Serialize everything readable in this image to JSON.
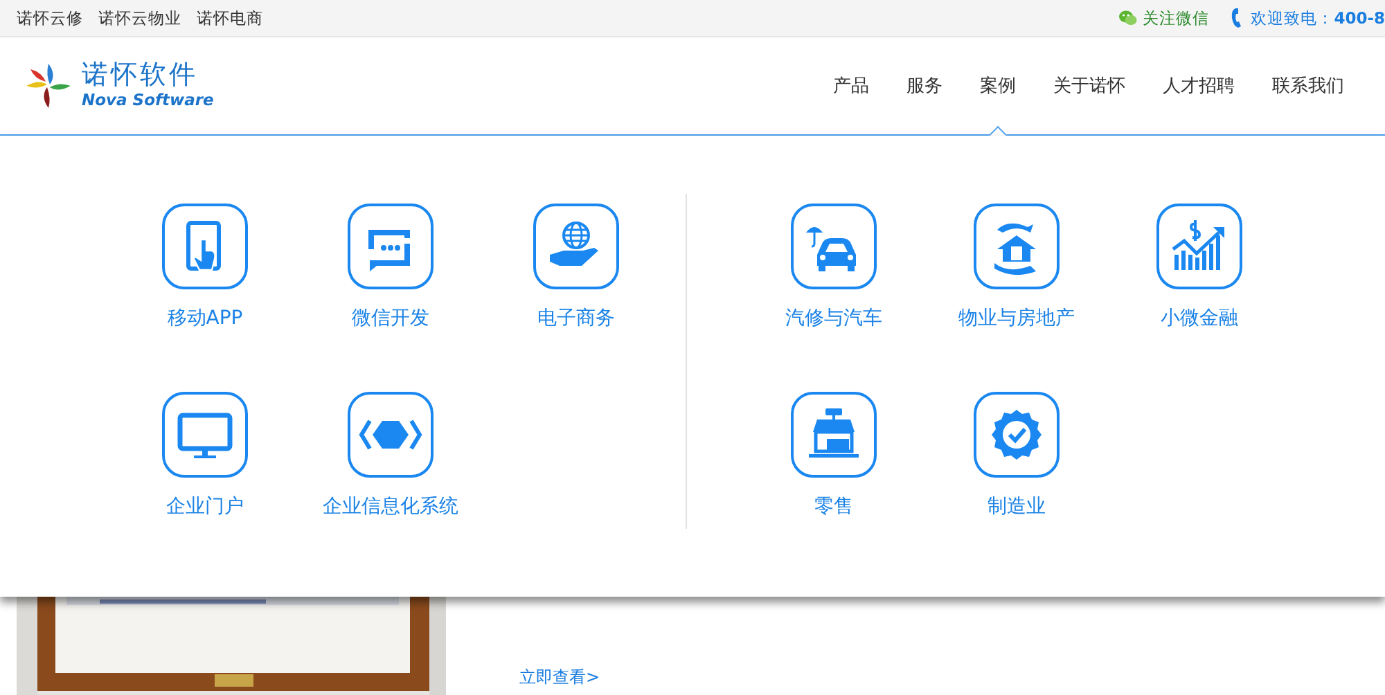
{
  "top_bar": {
    "links": [
      "诺怀云修",
      "诺怀云物业",
      "诺怀电商"
    ],
    "wechat": "关注微信",
    "phone_label": "欢迎致电：",
    "phone_number": "400-8"
  },
  "logo": {
    "name": "诺怀软件",
    "subtitle": "Nova Software"
  },
  "nav": [
    {
      "label": "产品",
      "selected": false
    },
    {
      "label": "服务",
      "selected": false
    },
    {
      "label": "案例",
      "selected": true
    },
    {
      "label": "关于诺怀",
      "selected": false
    },
    {
      "label": "人才招聘",
      "selected": false
    },
    {
      "label": "联系我们",
      "selected": false
    }
  ],
  "menu": {
    "groups": [
      {
        "items": [
          {
            "label": "移动APP"
          },
          {
            "label": "微信开发"
          },
          {
            "label": "电子商务"
          },
          {
            "label": "企业门户"
          },
          {
            "label": "企业信息化系统"
          }
        ]
      },
      {
        "items": [
          {
            "label": "汽修与汽车"
          },
          {
            "label": "物业与房地产"
          },
          {
            "label": "小微金融"
          },
          {
            "label": "零售"
          },
          {
            "label": "制造业"
          }
        ]
      }
    ]
  },
  "below": {
    "link": "立即查看>"
  }
}
